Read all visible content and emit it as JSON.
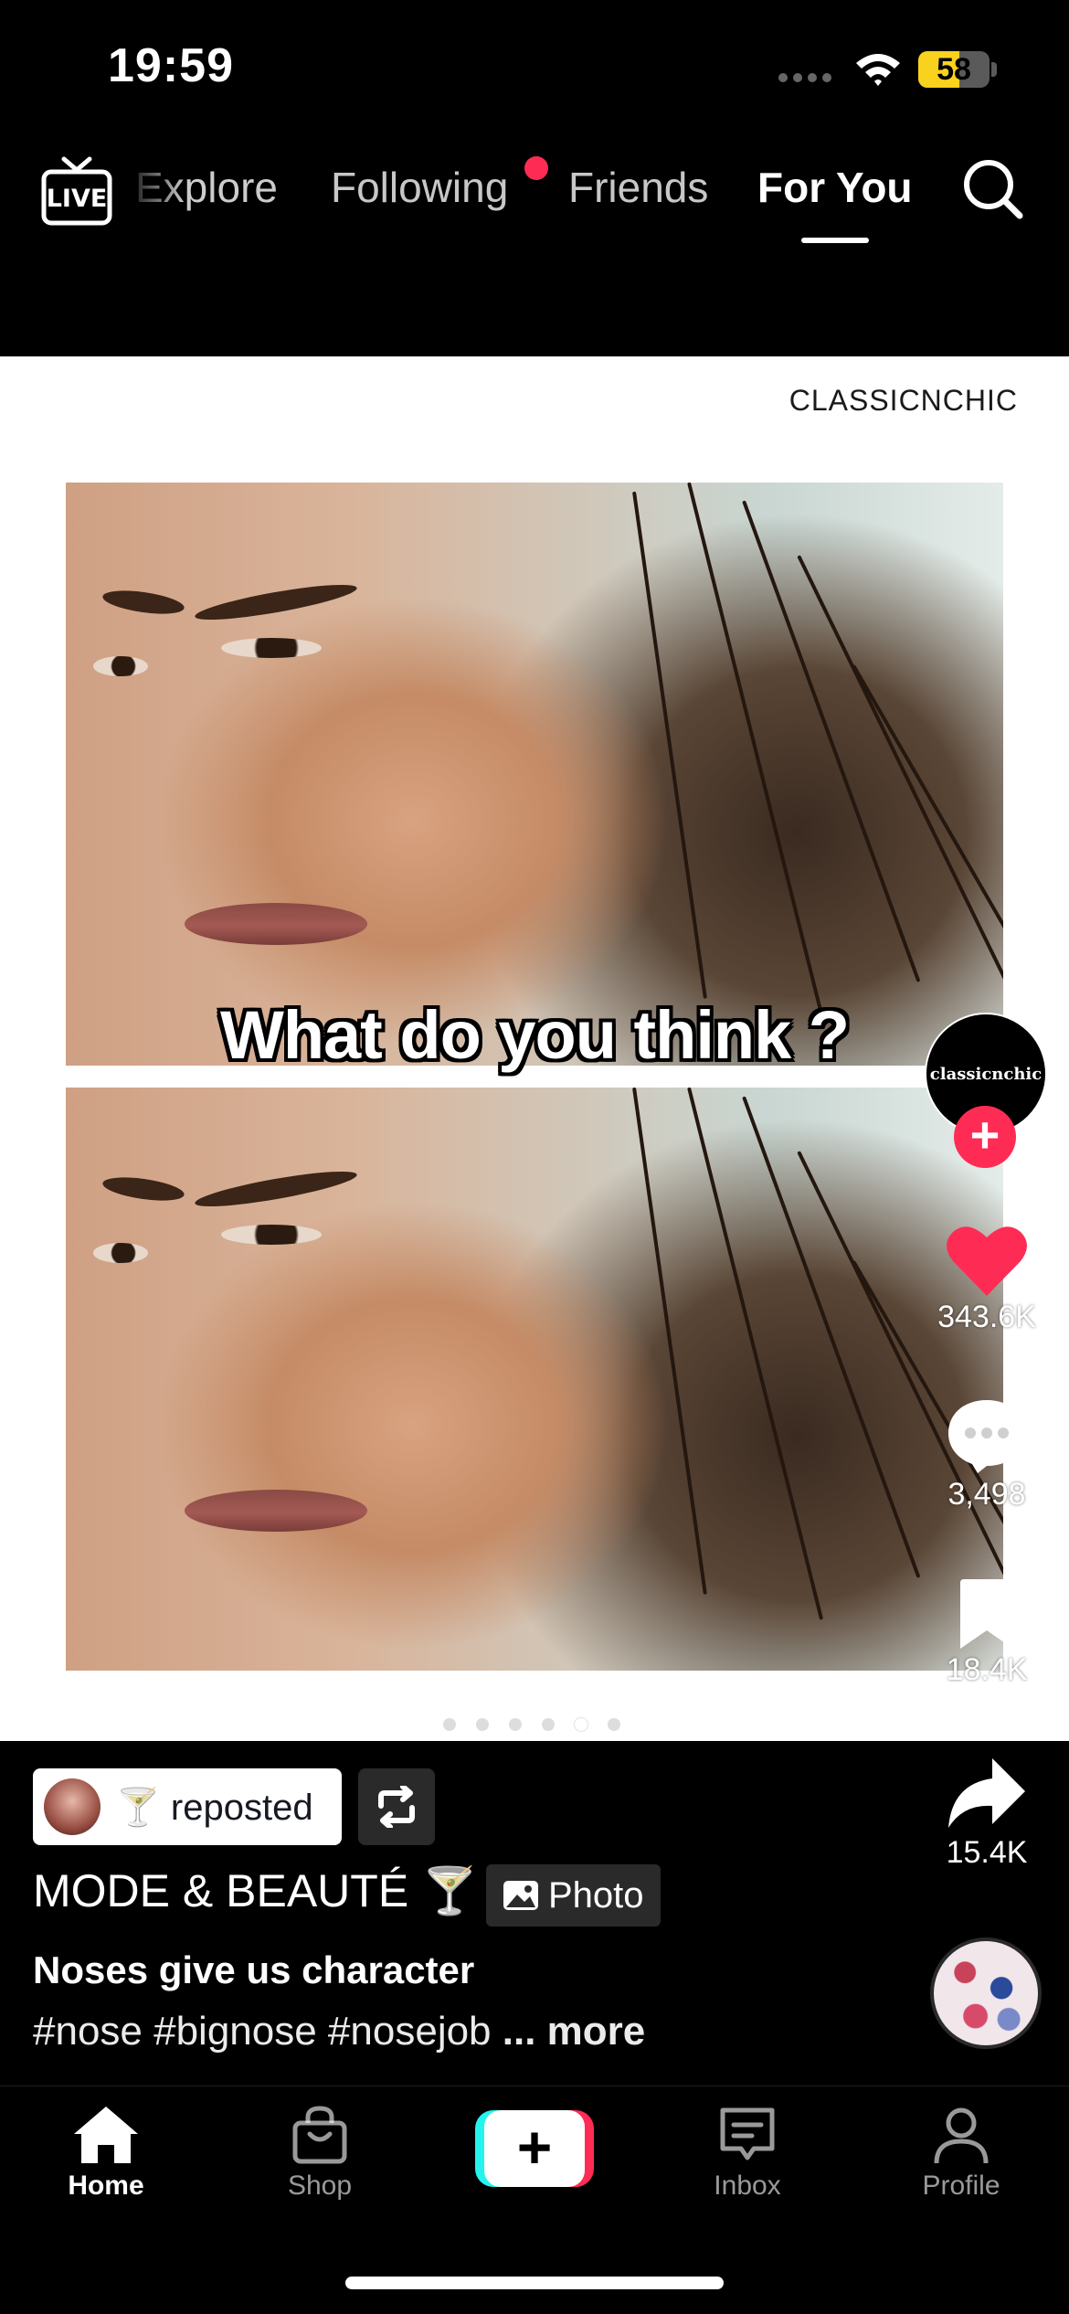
{
  "status_bar": {
    "time": "19:59",
    "battery": "58",
    "battery_level": 0.58
  },
  "top_nav": {
    "live_label": "LIVE",
    "tabs": [
      "Explore",
      "Following",
      "Friends",
      "For You"
    ],
    "active_tab": "For You"
  },
  "post": {
    "author_watermark": "CLASSICNCHIC",
    "overlay_caption": "What do you think ?",
    "creator_avatar_text": "classicnchic",
    "likes": "343.6K",
    "comments": "3,498",
    "saves": "18.4K",
    "shares": "15.4K",
    "carousel": {
      "count": 6,
      "active_index": 4
    }
  },
  "info": {
    "repost_label": "🍸 reposted",
    "account_name": "MODE & BEAUTÉ 🍸",
    "badge_label": "Photo",
    "title": "Noses give us character",
    "hashtags": "#nose #bignose #nosejob",
    "more_label": "... more"
  },
  "tab_bar": {
    "home": "Home",
    "shop": "Shop",
    "inbox": "Inbox",
    "profile": "Profile",
    "create_symbol": "+"
  },
  "colors": {
    "accent": "#fe2c55",
    "cyan": "#25f4ee",
    "battery": "#f8d21c"
  }
}
